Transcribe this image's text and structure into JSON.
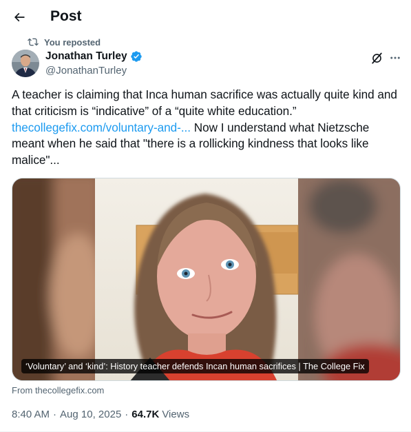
{
  "header": {
    "title": "Post"
  },
  "repost": {
    "label": "You reposted"
  },
  "author": {
    "name": "Jonathan Turley",
    "handle": "@JonathanTurley"
  },
  "tweet": {
    "text_before_link": "A teacher is claiming that Inca human sacrifice was actually quite kind and that criticism is “indicative” of a “quite white education.”",
    "link_text": "thecollegefix.com/voluntary-and-...",
    "text_after_link": "Now I understand what Nietzsche meant when he said that \"there is a rollicking kindness that looks like malice\"..."
  },
  "card": {
    "caption": "‘Voluntary’ and ‘kind’: History teacher defends Incan human sacrifices | The College Fix",
    "source": "From thecollegefix.com"
  },
  "meta": {
    "time": "8:40 AM",
    "separator": "·",
    "date": "Aug 10, 2025",
    "views_count": "64.7K",
    "views_label": "Views"
  },
  "colors": {
    "link": "#1d9bf0",
    "verified_badge": "#1d9bf0",
    "secondary_text": "#536471",
    "primary_text": "#0f1419"
  },
  "icons": {
    "back": "arrow-left-icon",
    "repost": "repost-icon",
    "verified": "verified-badge-icon",
    "grok": "grok-icon",
    "more": "more-horizontal-icon"
  }
}
